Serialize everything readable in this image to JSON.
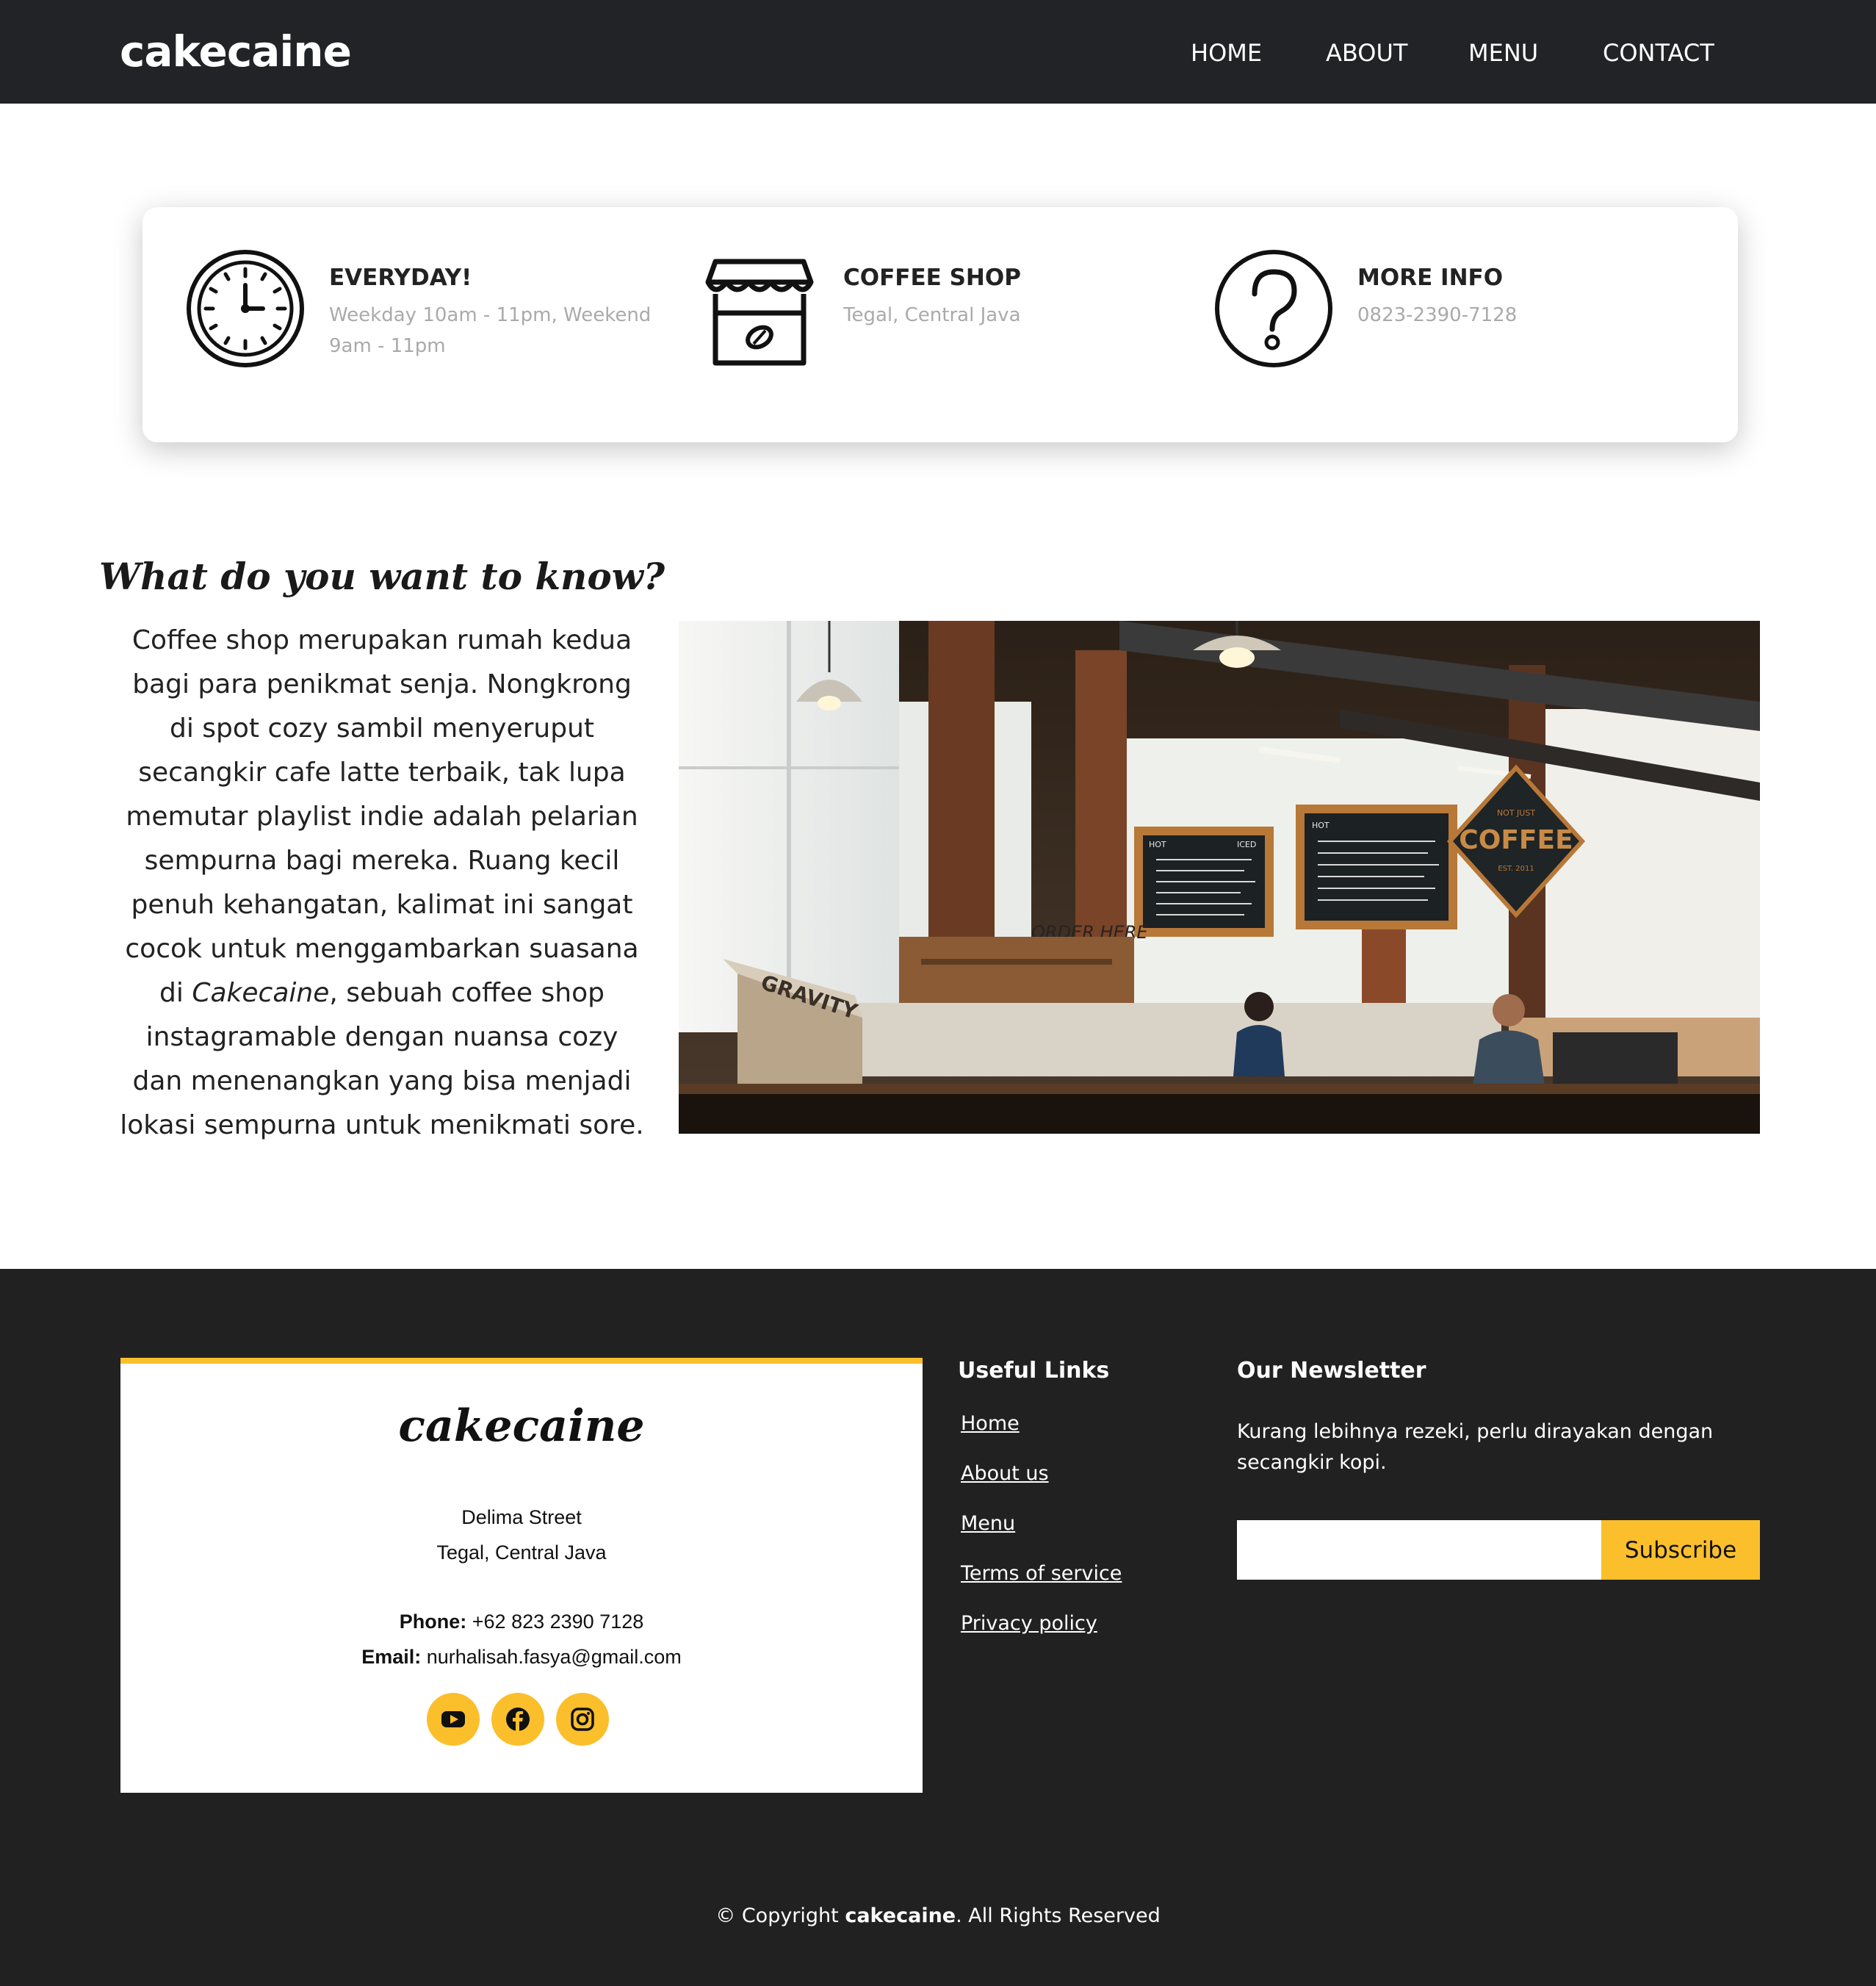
{
  "header": {
    "brand": "cakecaine",
    "nav": [
      {
        "label": "HOME"
      },
      {
        "label": "ABOUT"
      },
      {
        "label": "MENU"
      },
      {
        "label": "CONTACT"
      }
    ]
  },
  "info": [
    {
      "icon": "clock-icon",
      "title": "EVERYDAY!",
      "text": "Weekday 10am - 11pm, Weekend 9am - 11pm"
    },
    {
      "icon": "storefront-icon",
      "title": "COFFEE SHOP",
      "text": "Tegal, Central Java"
    },
    {
      "icon": "question-icon",
      "title": "MORE INFO",
      "text": "0823-2390-7128"
    }
  ],
  "about": {
    "heading": "What do you want to know?",
    "text_before": "Coffee shop merupakan rumah kedua bagi para penikmat senja.  Nongkrong di spot cozy sambil menyeruput secangkir cafe latte terbaik, tak lupa memutar playlist indie adalah pelarian sempurna bagi mereka.  Ruang kecil penuh kehangatan, kalimat ini sangat cocok untuk menggambarkan suasana di ",
    "text_italic": "Cakecaine",
    "text_after": ", sebuah coffee shop instagramable dengan nuansa cozy dan menenangkan yang bisa menjadi lokasi sempurna untuk menikmati sore.",
    "photo_signs": {
      "menu_left_header": "HOT",
      "menu_left_iced": "ICED",
      "menu_right_header": "HOT",
      "order_here": "ORDER HERE",
      "coffee_sign_top": "NOT JUST",
      "coffee_sign_main": "COFFEE",
      "coffee_sign_est": "EST. 2011",
      "box_brand": "GRAVITY"
    }
  },
  "footer": {
    "contact": {
      "brand": "cakecaine",
      "street": "Delima Street",
      "city": "Tegal, Central Java",
      "phone_label": "Phone:",
      "phone": "+62 823 2390 7128",
      "email_label": "Email:",
      "email": "nurhalisah.fasya@gmail.com",
      "socials": [
        "youtube-icon",
        "facebook-icon",
        "instagram-icon"
      ]
    },
    "links": {
      "title": "Useful Links",
      "items": [
        "Home",
        "About us",
        "Menu",
        "Terms of service",
        "Privacy policy"
      ]
    },
    "newsletter": {
      "title": "Our Newsletter",
      "text": "Kurang lebihnya rezeki, perlu dirayakan dengan secangkir kopi.",
      "input_value": "",
      "button": "Subscribe"
    },
    "copyright": {
      "prefix": "© Copyright ",
      "brand": "cakecaine",
      "suffix": ". All Rights Reserved"
    }
  },
  "colors": {
    "header_bg": "#212326",
    "footer_bg": "#212121",
    "accent": "#fbbf2c"
  }
}
